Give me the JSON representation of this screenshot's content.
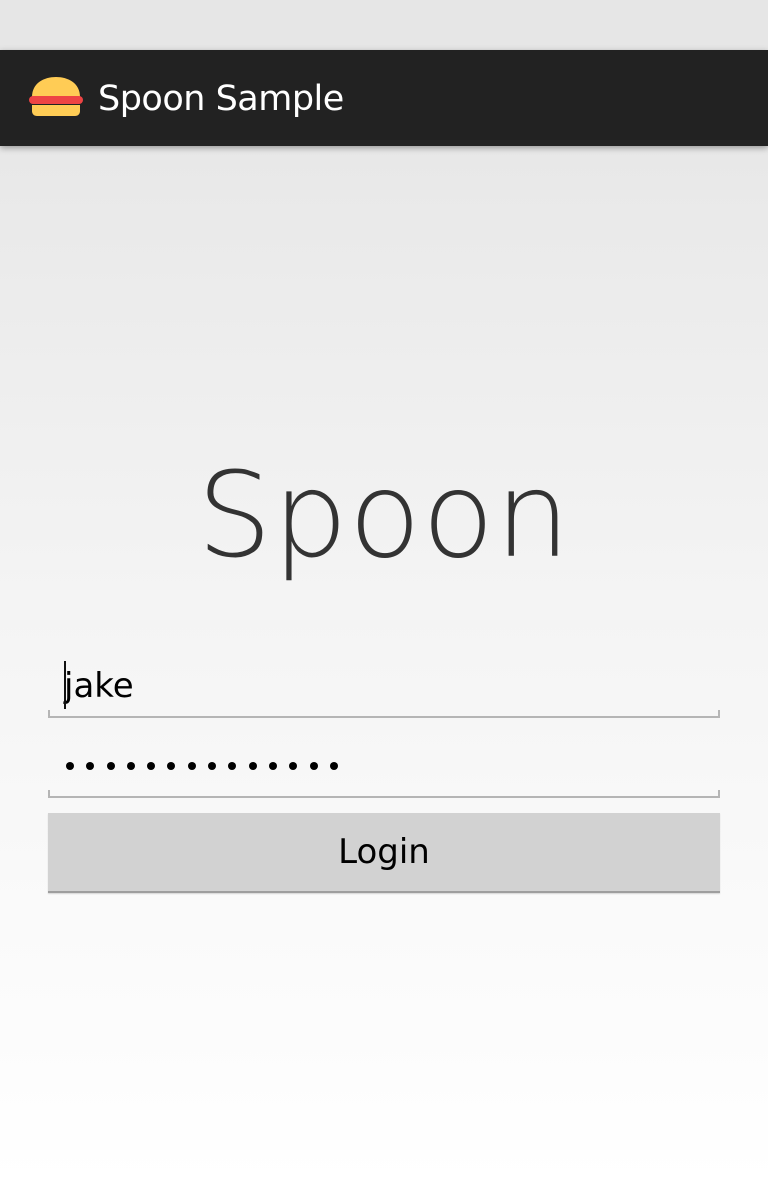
{
  "app": {
    "title": "Spoon Sample",
    "icon": "burger-icon"
  },
  "main": {
    "logo_text": "Spoon"
  },
  "form": {
    "username": {
      "value": "jake"
    },
    "password": {
      "masked_length": 14
    },
    "login_label": "Login"
  },
  "colors": {
    "action_bar": "#222222",
    "burger_bun": "#ffcc55",
    "burger_patty": "#ee4444",
    "button": "#d2d2d2"
  }
}
